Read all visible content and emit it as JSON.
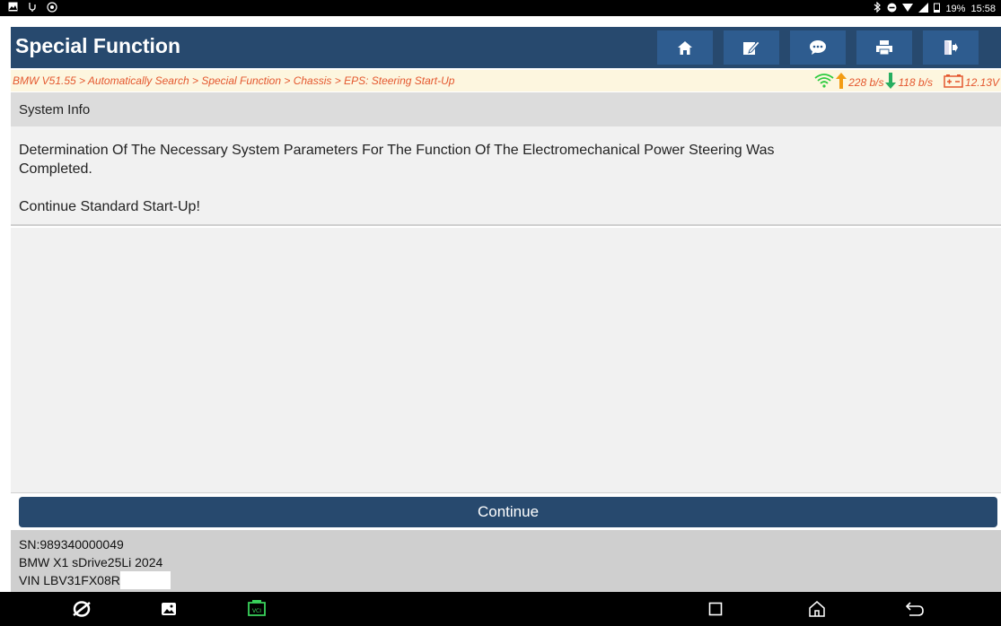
{
  "status_bar": {
    "left_icons": [
      "notification-image-icon",
      "usb-icon",
      "sync-icon"
    ],
    "battery": "19%",
    "time": "15:58"
  },
  "header": {
    "title": "Special Function",
    "buttons": [
      "home-icon",
      "edit-icon",
      "chat-icon",
      "print-icon",
      "exit-icon"
    ]
  },
  "breadcrumb": {
    "path": "BMW V51.55 > Automatically Search > Special Function > Chassis > EPS: Steering Start-Up",
    "upload": "228 b/s",
    "download": "118 b/s",
    "voltage": "12.13V"
  },
  "content": {
    "section_title": "System Info",
    "message_line1": " Determination Of The Necessary System Parameters For The Function Of The Electromechanical Power Steering Was",
    "message_line2": "Completed.",
    "message_line3": "Continue Standard Start-Up!"
  },
  "actions": {
    "continue_label": "Continue"
  },
  "footer": {
    "sn": "SN:989340000049",
    "vehicle": "BMW X1 sDrive25Li 2024",
    "vin": "VIN LBV31FX08R"
  },
  "colors": {
    "header_bg": "#27496e",
    "button_bg": "#2e5c8f",
    "breadcrumb_text": "#e4572e",
    "wifi": "#2ecc40",
    "upload_arrow": "#f39c12",
    "download_arrow": "#27ae60"
  }
}
